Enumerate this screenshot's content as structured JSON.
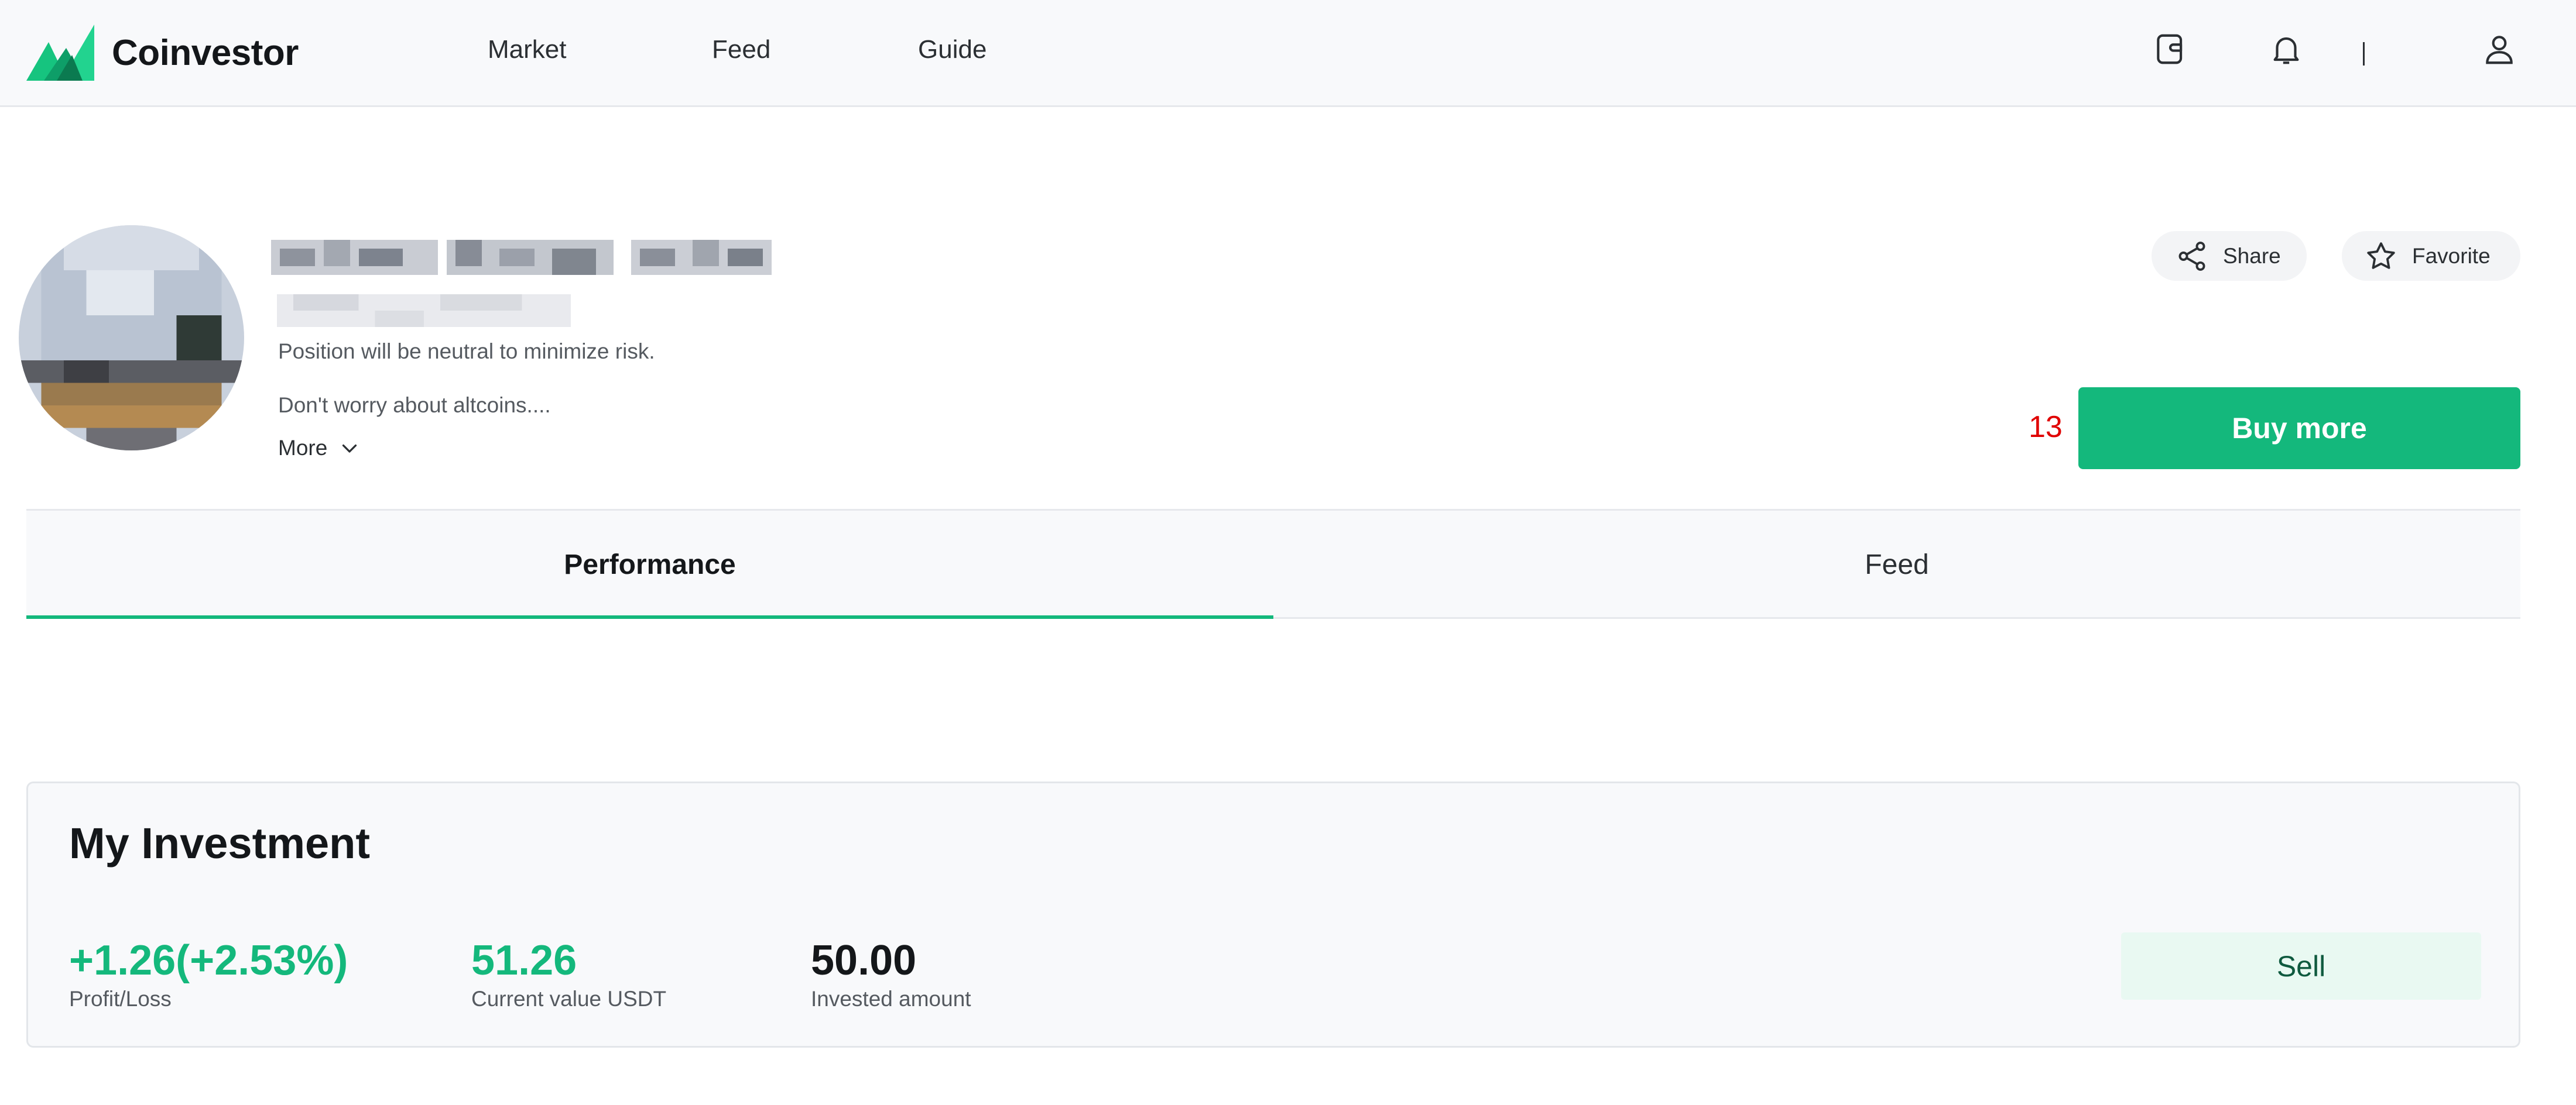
{
  "app": {
    "logo_text": "Coinvestor",
    "brand_color": "#14b87c"
  },
  "nav": {
    "items": [
      {
        "label": "Market"
      },
      {
        "label": "Feed"
      },
      {
        "label": "Guide"
      }
    ]
  },
  "header_icons": {
    "wallet": "wallet-icon",
    "notifications": "bell-icon",
    "divider": "|",
    "profile": "user-icon"
  },
  "profile": {
    "name": "",
    "subtitle": "",
    "bio_line_1": "Position will be neutral to minimize risk.",
    "bio_line_2": "Don't worry about altcoins....",
    "more_label": "More",
    "share_label": "Share",
    "favorite_label": "Favorite",
    "count": "13",
    "buy_label": "Buy more"
  },
  "tabs": [
    {
      "label": "Performance",
      "active": true
    },
    {
      "label": "Feed",
      "active": false
    }
  ],
  "investment": {
    "title": "My Investment",
    "stats": [
      {
        "value": "+1.26(+2.53%)",
        "label": "Profit/Loss"
      },
      {
        "value": "51.26",
        "label": "Current value USDT"
      },
      {
        "value": "50.00",
        "label": "Invested amount"
      }
    ],
    "sell_label": "Sell"
  }
}
